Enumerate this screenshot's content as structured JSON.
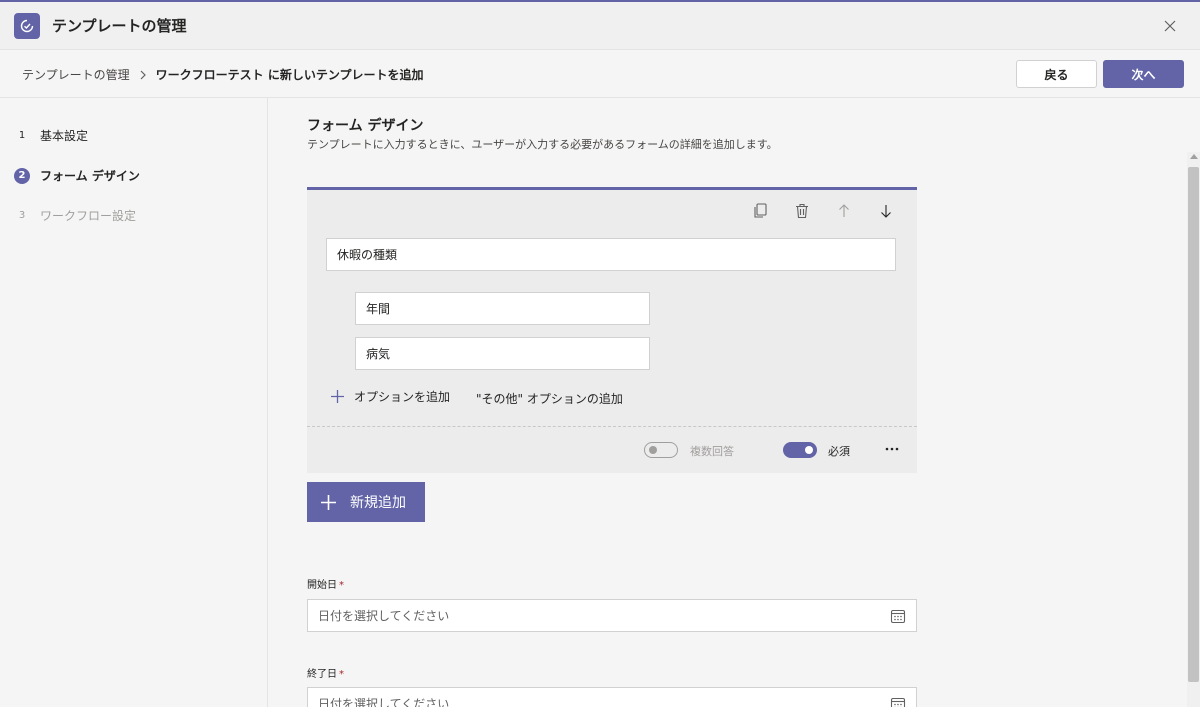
{
  "window": {
    "title": "テンプレートの管理"
  },
  "breadcrumb": {
    "root": "テンプレートの管理",
    "current": "ワークフローテスト に新しいテンプレートを追加"
  },
  "actions": {
    "back_label": "戻る",
    "next_label": "次へ"
  },
  "steps": [
    {
      "num": "1",
      "label": "基本設定"
    },
    {
      "num": "2",
      "label": "フォーム デザイン"
    },
    {
      "num": "3",
      "label": "ワークフロー設定"
    }
  ],
  "main": {
    "title": "フォーム デザイン",
    "description": "テンプレートに入力するときに、ユーザーが入力する必要があるフォームの詳細を追加します。"
  },
  "question_card": {
    "question": "休暇の種類",
    "options": [
      "年間",
      "病気"
    ],
    "add_option_label": "オプションを追加",
    "add_other_label": "\"その他\" オプションの追加",
    "multiple_answers_label": "複数回答",
    "multiple_answers_on": false,
    "required_label": "必須",
    "required_on": true
  },
  "new_button_label": "新規追加",
  "fields": [
    {
      "label": "開始日",
      "required_mark": "*",
      "placeholder": "日付を選択してください"
    },
    {
      "label": "終了日",
      "required_mark": "*",
      "placeholder": "日付を選択してください"
    }
  ],
  "colors": {
    "accent": "#6264a7",
    "required": "#a4262c"
  }
}
